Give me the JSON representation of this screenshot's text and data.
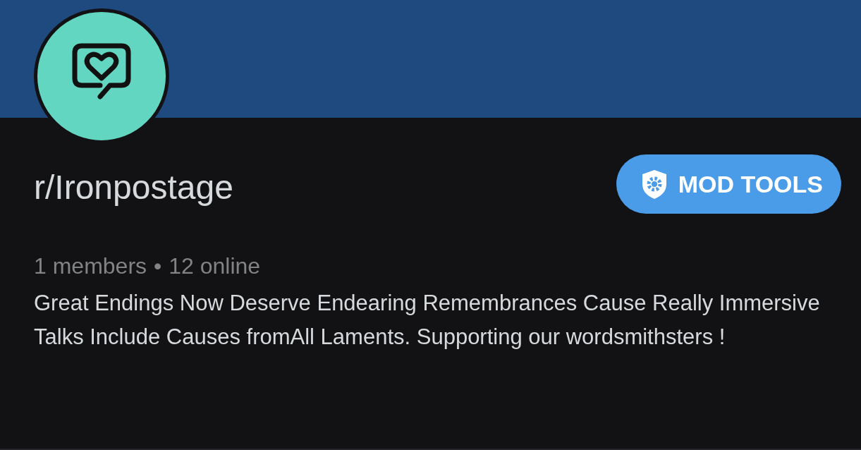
{
  "community": {
    "name": "r/Ironpostage",
    "members": "1 members",
    "separator": "•",
    "online": "12 online",
    "description": "Great Endings Now Deserve Endearing Remembrances Cause Really Immersive Talks Include Causes fromAll Laments. Supporting our wordsmithsters !"
  },
  "mod_tools_button": {
    "label": "MOD TOOLS"
  }
}
